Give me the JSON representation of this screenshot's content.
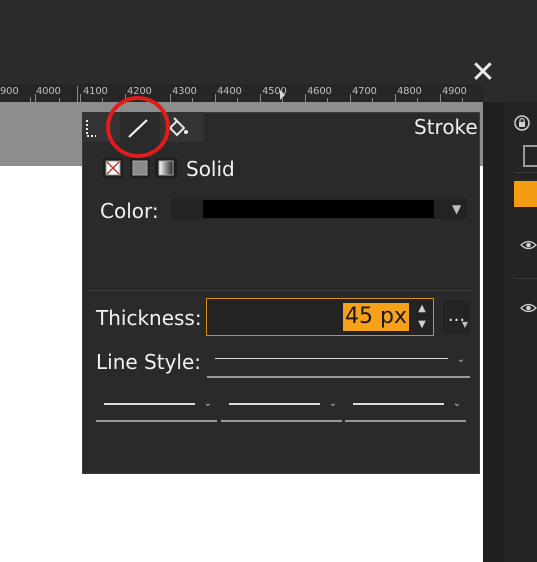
{
  "ruler": {
    "labels": [
      "900",
      "4000",
      "4100",
      "4200",
      "4300",
      "4400",
      "4500",
      "4600",
      "4700",
      "4800",
      "4900"
    ]
  },
  "window": {
    "close_label": "✕"
  },
  "stroke_panel": {
    "title": "Stroke",
    "tabs": [
      {
        "icon": "dotted-rect-icon"
      },
      {
        "icon": "line-tool-icon"
      },
      {
        "icon": "paint-bucket-icon"
      }
    ],
    "style_label": "Solid",
    "color_label": "Color:",
    "color_value": "#000000",
    "thickness_label": "Thickness:",
    "thickness_value": "45 px",
    "more_label": "...",
    "line_style_label": "Line Style:"
  },
  "colors": {
    "accent": "#f7a11a",
    "highlight_circle": "#e21b1b"
  }
}
